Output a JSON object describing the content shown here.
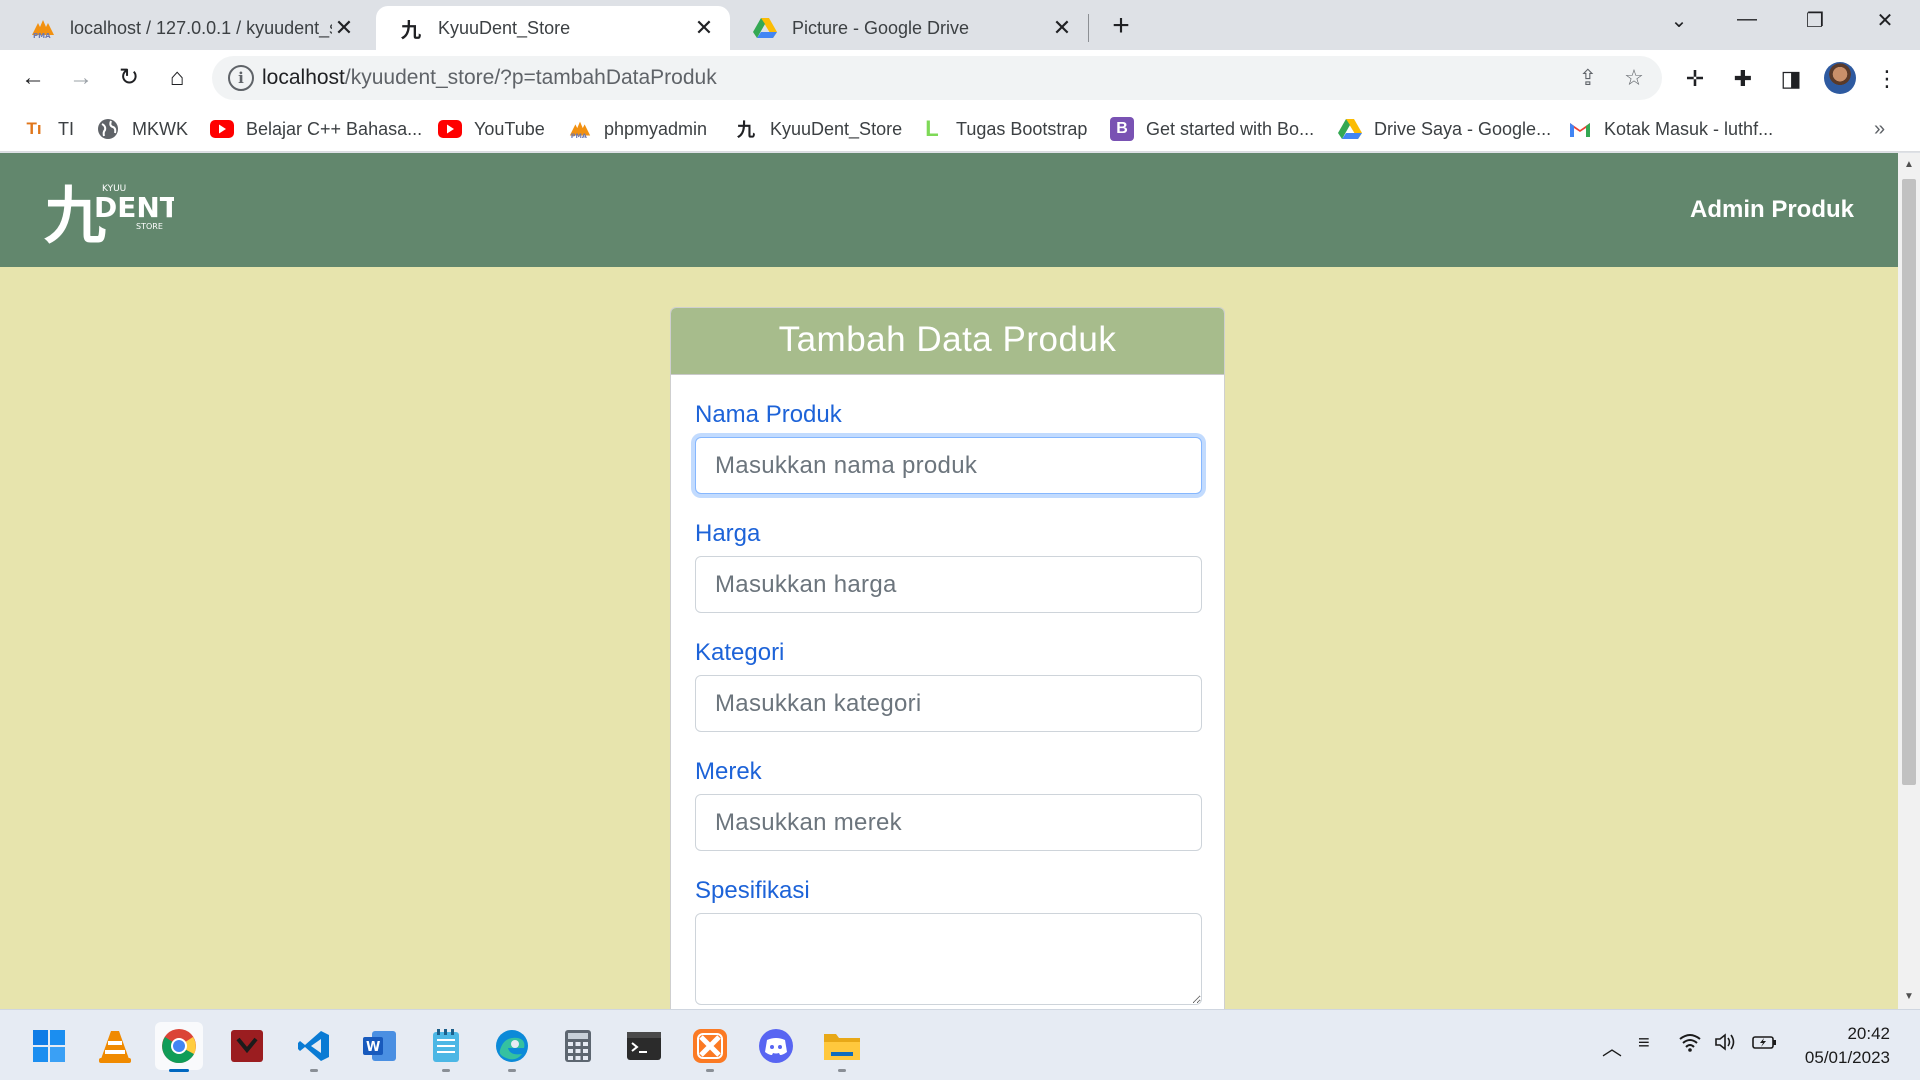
{
  "browser": {
    "tabs": [
      {
        "title": "localhost / 127.0.0.1 / kyuudent_s",
        "icon": "phpmyadmin-icon"
      },
      {
        "title": "KyuuDent_Store",
        "icon": "kyuudent-icon"
      },
      {
        "title": "Picture - Google Drive",
        "icon": "google-drive-icon"
      }
    ],
    "address": {
      "host": "localhost",
      "path": "/kyuudent_store/?p=tambahDataProduk"
    },
    "bookmarks": [
      {
        "label": "TI",
        "icon": "ti-icon"
      },
      {
        "label": "MKWK",
        "icon": "globe-icon"
      },
      {
        "label": "Belajar C++ Bahasa...",
        "icon": "youtube-icon"
      },
      {
        "label": "YouTube",
        "icon": "youtube-icon"
      },
      {
        "label": "phpmyadmin",
        "icon": "phpmyadmin-icon"
      },
      {
        "label": "KyuuDent_Store",
        "icon": "kyuudent-icon"
      },
      {
        "label": "Tugas Bootstrap",
        "icon": "l-icon"
      },
      {
        "label": "Get started with Bo...",
        "icon": "bootstrap-icon"
      },
      {
        "label": "Drive Saya - Google...",
        "icon": "google-drive-icon"
      },
      {
        "label": "Kotak Masuk - luthf...",
        "icon": "gmail-icon"
      }
    ],
    "bookmarks_overflow": "»"
  },
  "site": {
    "brand": {
      "line1": "KYUU",
      "line2": "DENT",
      "line3": "STORE",
      "glyph": "九"
    },
    "nav_link": "Admin Produk",
    "accent": "#62876d",
    "background": "#e7e4ad"
  },
  "form": {
    "title": "Tambah Data Produk",
    "fields": [
      {
        "label": "Nama Produk",
        "placeholder": "Masukkan nama produk",
        "value": ""
      },
      {
        "label": "Harga",
        "placeholder": "Masukkan harga",
        "value": ""
      },
      {
        "label": "Kategori",
        "placeholder": "Masukkan kategori",
        "value": ""
      },
      {
        "label": "Merek",
        "placeholder": "Masukkan merek",
        "value": ""
      },
      {
        "label": "Spesifikasi",
        "placeholder": "",
        "value": ""
      }
    ]
  },
  "taskbar": {
    "apps": [
      "start-icon",
      "vlc-icon",
      "chrome-icon",
      "mendeley-icon",
      "vscode-icon",
      "word-icon",
      "notepad-icon",
      "edge-icon",
      "calculator-icon",
      "terminal-icon",
      "xampp-icon",
      "discord-icon",
      "file-explorer-icon"
    ],
    "time": "20:42",
    "date": "05/01/2023"
  }
}
